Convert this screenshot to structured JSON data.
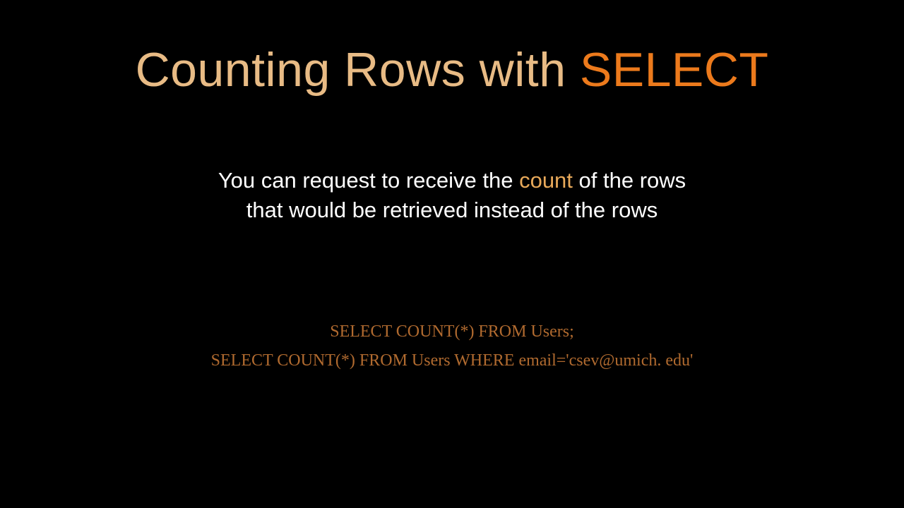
{
  "title": {
    "prefix": "Counting Rows with ",
    "highlight": "SELECT"
  },
  "body": {
    "before": "You can request to receive the ",
    "highlight": "count",
    "after_line1": " of the rows",
    "line2": "that would be retrieved instead of the rows"
  },
  "code": {
    "line1": "SELECT COUNT(*) FROM Users;",
    "line2": "SELECT COUNT(*) FROM Users WHERE email='csev@umich. edu'"
  }
}
